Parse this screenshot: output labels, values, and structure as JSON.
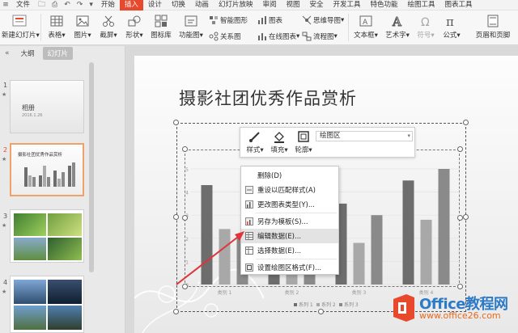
{
  "menubar": {
    "items": [
      "文件",
      "开始",
      "插入",
      "设计",
      "切换",
      "动画",
      "幻灯片放映",
      "审阅",
      "视图",
      "安全",
      "开发工具",
      "特色功能",
      "绘图工具",
      "图表工具"
    ],
    "active_index": 2
  },
  "ribbon": {
    "new_slide": "新建幻灯片",
    "table": "表格",
    "picture": "图片",
    "screenshot": "截屏",
    "shape": "形状",
    "icon_lib": "图标库",
    "function_chart": "功能图",
    "smart_graphic": "智能图形",
    "chart": "图表",
    "mindmap": "思维导图",
    "relationship": "关系图",
    "online_chart": "在线图表",
    "flowchart": "流程图",
    "textbox": "文本框",
    "wordart": "艺术字",
    "symbol": "符号",
    "formula": "公式",
    "header_footer": "页眉和页脚"
  },
  "left_pane": {
    "tabs": [
      "大纲",
      "幻灯片"
    ],
    "active_tab": 1,
    "thumbs": [
      {
        "num": "1",
        "title": "相册",
        "subtitle": "2016.1.26"
      },
      {
        "num": "2",
        "title": "摄影社团优秀作品赏析"
      },
      {
        "num": "3"
      },
      {
        "num": "4"
      }
    ],
    "selected": 1
  },
  "slide": {
    "title": "摄影社团优秀作品赏析"
  },
  "mini_toolbar": {
    "style": "样式",
    "fill": "填充",
    "outline": "轮廓",
    "selector": "绘图区"
  },
  "context_menu": {
    "items": [
      "删除(D)",
      "重设以匹配样式(A)",
      "更改图表类型(Y)...",
      "另存为模板(S)...",
      "编辑数据(E)...",
      "选择数据(E)...",
      "设置绘图区格式(F)..."
    ],
    "highlighted": 4
  },
  "chart_data": {
    "type": "bar",
    "categories": [
      "类别 1",
      "类别 2",
      "类别 3",
      "类别 4"
    ],
    "series": [
      {
        "name": "系列 1",
        "values": [
          4.3,
          2.5,
          3.5,
          4.5
        ],
        "color": "#6d6d6d"
      },
      {
        "name": "系列 2",
        "values": [
          2.4,
          4.4,
          1.8,
          2.8
        ],
        "color": "#a8a8a8"
      },
      {
        "name": "系列 3",
        "values": [
          2.0,
          2.0,
          3.0,
          5.0
        ],
        "color": "#8a8a8a"
      }
    ],
    "ylim": [
      0,
      5
    ],
    "yticks": [
      "0",
      "1",
      "2",
      "3",
      "4",
      "5"
    ],
    "legend_placement": "bottom"
  },
  "watermark": {
    "text": "Office教程网",
    "sub": "www.office26.com"
  },
  "colors": {
    "accent": "#e8492d",
    "watermark_blue": "#2d7ac6",
    "watermark_orange": "#e86a1c"
  }
}
